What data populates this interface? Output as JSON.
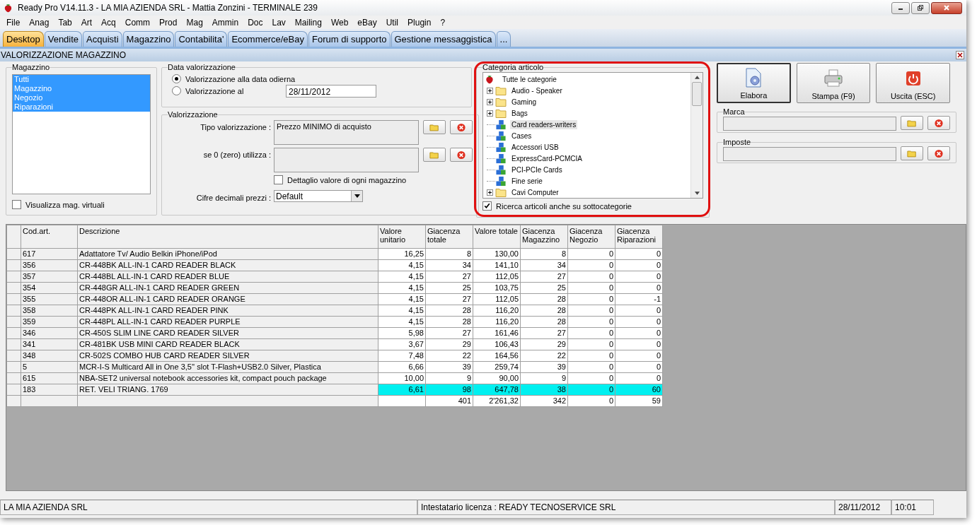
{
  "window": {
    "title": "Ready Pro V14.11.3 - LA MIA AZIENDA SRL - Mattia Zonzini - TERMINALE 239"
  },
  "menu": [
    "File",
    "Anag",
    "Tab",
    "Art",
    "Acq",
    "Comm",
    "Prod",
    "Mag",
    "Ammin",
    "Doc",
    "Lav",
    "Mailing",
    "Web",
    "eBay",
    "Util",
    "Plugin",
    "?"
  ],
  "tabs": [
    {
      "label": "Desktop",
      "selected": true
    },
    {
      "label": "Vendite",
      "selected": false
    },
    {
      "label": "Acquisti",
      "selected": false
    },
    {
      "label": "Magazzino",
      "selected": false
    },
    {
      "label": "Contabilita'",
      "selected": false
    },
    {
      "label": "Ecommerce/eBay",
      "selected": false
    },
    {
      "label": "Forum di supporto",
      "selected": false
    },
    {
      "label": "Gestione messaggistica",
      "selected": false
    },
    {
      "label": "...",
      "selected": false
    }
  ],
  "form_title": "VALORIZZAZIONE MAGAZZINO",
  "magazzino": {
    "legend": "Magazzino",
    "items": [
      {
        "label": "Tutti",
        "selected": true
      },
      {
        "label": "Magazzino",
        "selected": true
      },
      {
        "label": "Negozio",
        "selected": true
      },
      {
        "label": "Riparazioni",
        "selected": true
      }
    ],
    "virtual": {
      "label": "Visualizza mag. virtuali",
      "checked": false
    }
  },
  "data_valorizzazione": {
    "legend": "Data valorizzazione",
    "options": [
      {
        "label": "Valorizzazione alla data odierna",
        "selected": true
      },
      {
        "label": "Valorizzazione al",
        "selected": false
      }
    ],
    "date": "28/11/2012"
  },
  "valorizzazione": {
    "legend": "Valorizzazione",
    "tipo_label": "Tipo valorizzazione :",
    "tipo_value": "Prezzo MINIMO di acquisto",
    "zero_label": "se 0 (zero) utilizza :",
    "detail": {
      "label": "Dettaglio valore di ogni magazzino",
      "checked": false
    },
    "decimals_label": "Cifre decimali prezzi :",
    "decimals_value": "Default"
  },
  "categoria": {
    "legend": "Categoria articolo",
    "root": {
      "label": "Tutte le categorie",
      "children": [
        {
          "label": "Audio - Speaker",
          "kind": "folder",
          "expanded": false,
          "selected": false
        },
        {
          "label": "Gaming",
          "kind": "folder",
          "expanded": false,
          "selected": false
        },
        {
          "label": "Bags",
          "kind": "folder",
          "expanded": false,
          "selected": false
        },
        {
          "label": "Card readers-writers",
          "kind": "leaf",
          "selected": true
        },
        {
          "label": "Cases",
          "kind": "leaf",
          "selected": false
        },
        {
          "label": "Accessori USB",
          "kind": "leaf",
          "selected": false
        },
        {
          "label": "ExpressCard-PCMCIA",
          "kind": "leaf",
          "selected": false
        },
        {
          "label": "PCI-PCIe Cards",
          "kind": "leaf",
          "selected": false
        },
        {
          "label": "Fine serie",
          "kind": "leaf",
          "selected": false
        },
        {
          "label": "Cavi Computer",
          "kind": "folder",
          "expanded": false,
          "selected": false
        }
      ]
    },
    "subcategories": {
      "label": "Ricerca articoli anche su sottocategorie",
      "checked": true
    }
  },
  "buttons": [
    {
      "label": "Elabora",
      "kind": "process"
    },
    {
      "label": "Stampa (F9)",
      "kind": "print"
    },
    {
      "label": "Uscita (ESC)",
      "kind": "exit"
    }
  ],
  "marca": {
    "legend": "Marca"
  },
  "imposte": {
    "legend": "Imposte"
  },
  "table": {
    "columns": [
      "Cod.art.",
      "Descrizione",
      "Valore unitario",
      "Giacenza totale",
      "Valore totale",
      "Giacenza Magazzino",
      "Giacenza Negozio",
      "Giacenza Riparazioni"
    ],
    "rows": [
      {
        "cells": [
          "617",
          "Adattatore Tv/ Audio Belkin iPhone/iPod",
          "16,25",
          "8",
          "130,00",
          "8",
          "0",
          "0"
        ],
        "highlighted": false
      },
      {
        "cells": [
          "356",
          "CR-448BK ALL-IN-1 CARD READER BLACK",
          "4,15",
          "34",
          "141,10",
          "34",
          "0",
          "0"
        ],
        "highlighted": false
      },
      {
        "cells": [
          "357",
          "CR-448BL ALL-IN-1 CARD READER BLUE",
          "4,15",
          "27",
          "112,05",
          "27",
          "0",
          "0"
        ],
        "highlighted": false
      },
      {
        "cells": [
          "354",
          "CR-448GR ALL-IN-1 CARD READER GREEN",
          "4,15",
          "25",
          "103,75",
          "25",
          "0",
          "0"
        ],
        "highlighted": false
      },
      {
        "cells": [
          "355",
          "CR-448OR ALL-IN-1 CARD READER ORANGE",
          "4,15",
          "27",
          "112,05",
          "28",
          "0",
          "-1"
        ],
        "highlighted": false
      },
      {
        "cells": [
          "358",
          "CR-448PK ALL-IN-1 CARD READER PINK",
          "4,15",
          "28",
          "116,20",
          "28",
          "0",
          "0"
        ],
        "highlighted": false
      },
      {
        "cells": [
          "359",
          "CR-448PL ALL-IN-1 CARD READER PURPLE",
          "4,15",
          "28",
          "116,20",
          "28",
          "0",
          "0"
        ],
        "highlighted": false
      },
      {
        "cells": [
          "346",
          "CR-450S SLIM LINE CARD READER SILVER",
          "5,98",
          "27",
          "161,46",
          "27",
          "0",
          "0"
        ],
        "highlighted": false
      },
      {
        "cells": [
          "341",
          "CR-481BK USB MINI CARD READER BLACK",
          "3,67",
          "29",
          "106,43",
          "29",
          "0",
          "0"
        ],
        "highlighted": false
      },
      {
        "cells": [
          "348",
          "CR-502S COMBO HUB CARD READER SILVER",
          "7,48",
          "22",
          "164,56",
          "22",
          "0",
          "0"
        ],
        "highlighted": false
      },
      {
        "cells": [
          "5",
          "MCR-I-S Multicard All in One 3,5'' slot T-Flash+USB2.0 Silver, Plastica",
          "6,66",
          "39",
          "259,74",
          "39",
          "0",
          "0"
        ],
        "highlighted": false
      },
      {
        "cells": [
          "615",
          "NBA-SET2 universal notebook accessories kit, compact pouch package",
          "10,00",
          "9",
          "90,00",
          "9",
          "0",
          "0"
        ],
        "highlighted": false
      },
      {
        "cells": [
          "183",
          "RET. VELI TRIANG. 1769",
          "6,61",
          "98",
          "647,78",
          "38",
          "0",
          "60"
        ],
        "highlighted": true
      }
    ],
    "totals": [
      "401",
      "2'261,32",
      "342",
      "0",
      "59"
    ]
  },
  "status_bar": {
    "company": "LA MIA AZIENDA SRL",
    "license": "Intestatario licenza : READY TECNOSERVICE SRL",
    "date": "28/11/2012",
    "time": "10:01"
  }
}
